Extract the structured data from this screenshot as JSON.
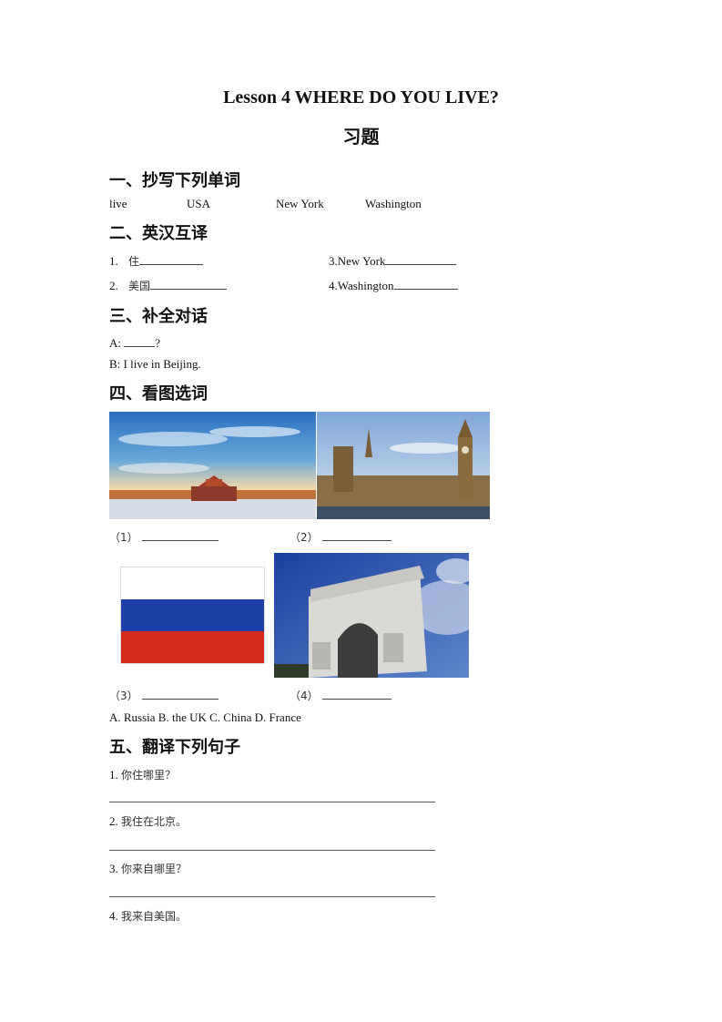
{
  "document": {
    "title": "Lesson 4 WHERE DO YOU LIVE?",
    "subtitle": "习题"
  },
  "section1": {
    "heading": "一、抄写下列单词",
    "words": [
      "live",
      "USA",
      "New York",
      "Washington"
    ]
  },
  "section2": {
    "heading": "二、英汉互译",
    "items": [
      {
        "num": "1.",
        "text": "住"
      },
      {
        "num": "2.",
        "text": "美国"
      },
      {
        "num": "3.",
        "text": "New York"
      },
      {
        "num": "4.",
        "text": "Washington"
      }
    ]
  },
  "section3": {
    "heading": "三、补全对话",
    "line_a_prefix": "A:",
    "line_a_suffix": "?",
    "line_b": "B: I live in Beijing."
  },
  "section4": {
    "heading": "四、看图选词",
    "pictures": [
      {
        "label": "（1）",
        "icon": "forbidden-city-photo"
      },
      {
        "label": "（2）",
        "icon": "big-ben-photo"
      },
      {
        "label": "（3）",
        "icon": "russia-flag"
      },
      {
        "label": "（4）",
        "icon": "arc-de-triomphe-photo"
      }
    ],
    "options": "A. Russia B. the UK C. China D. France"
  },
  "section5": {
    "heading": "五、翻译下列句子",
    "sentences": [
      {
        "num": "1.",
        "text": "你住哪里？"
      },
      {
        "num": "2.",
        "text": "我住在北京。"
      },
      {
        "num": "3.",
        "text": "你来自哪里？"
      },
      {
        "num": "4.",
        "text": "我来自美国。"
      }
    ]
  },
  "colors": {
    "flag_white": "#ffffff",
    "flag_blue": "#1f3fa8",
    "flag_red": "#d52b1e"
  }
}
